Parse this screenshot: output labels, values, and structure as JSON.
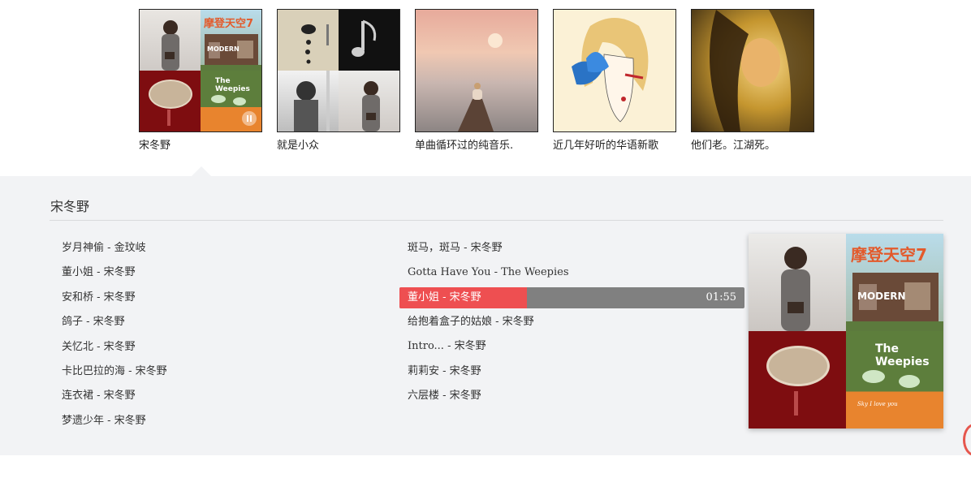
{
  "playlists": [
    {
      "title": "宋冬野",
      "cover_text": {
        "top_right": "摩登天空7",
        "modern": "MODERN",
        "weepies": "The Weepies",
        "weepies_sub": "Sky I love you"
      }
    },
    {
      "title": "就是小众"
    },
    {
      "title": "单曲循环过的纯音乐."
    },
    {
      "title": "近几年好听的华语新歌"
    },
    {
      "title": "他们老。江湖死。"
    }
  ],
  "panel": {
    "title": "宋冬野",
    "left_songs": [
      "岁月神偷 - 金玟岐",
      "董小姐 - 宋冬野",
      "安和桥 - 宋冬野",
      "鸽子 - 宋冬野",
      "关忆北 - 宋冬野",
      "卡比巴拉的海 - 宋冬野",
      "连衣裙 - 宋冬野",
      "梦遗少年 - 宋冬野"
    ],
    "right_songs": [
      "斑马，斑马 - 宋冬野",
      "Gotta Have You - The Weepies",
      "董小姐 - 宋冬野",
      "给抱着盒子的姑娘 - 宋冬野",
      "Intro... - 宋冬野",
      "莉莉安 - 宋冬野",
      "六层楼 - 宋冬野"
    ],
    "now_playing": {
      "index": 2,
      "time": "01:55",
      "progress": 0.37
    },
    "cover_text": {
      "top_right": "摩登天空7",
      "modern": "MODERN",
      "weepies": "The Weepies",
      "weepies_sub": "Sky I love you"
    }
  },
  "colors": {
    "accent": "#ee4f51",
    "panel_bg": "#f2f3f5",
    "track_gray": "#808080"
  }
}
